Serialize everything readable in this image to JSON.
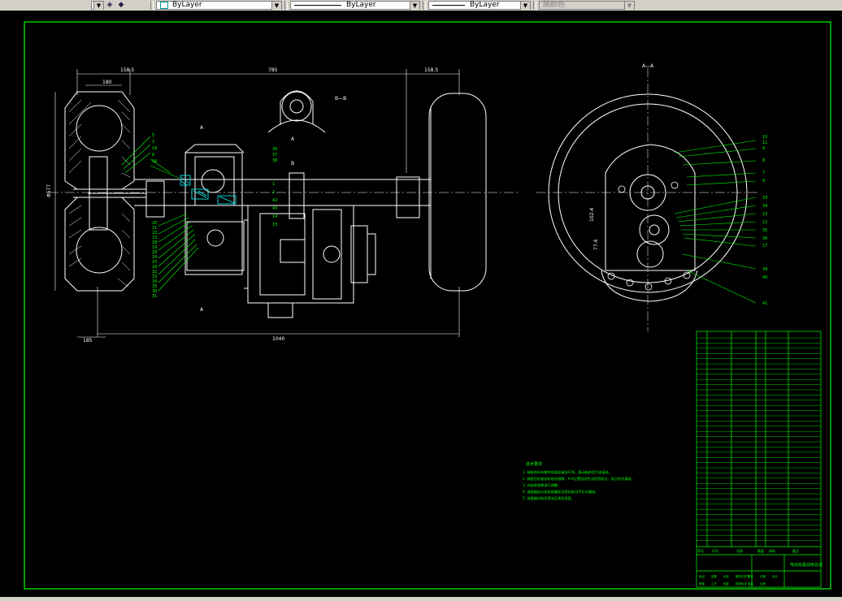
{
  "toolbar": {
    "layer_dropdown": "ByLayer",
    "linetype_dropdown": "ByLayer",
    "lineweight_dropdown": "ByLayer",
    "plotstyle_dropdown": "随颜色"
  },
  "colors": {
    "background": "#000000",
    "border": "#00ff00",
    "geometry": "#ffffff",
    "hatch": "#00ffff",
    "balloons": "#00ff00"
  },
  "drawing": {
    "dimensions": {
      "left_wheel_width": "158.5",
      "axle_span": "785",
      "right_wheel_width": "158.5",
      "inner_width": "180",
      "wheel_diameter": "Φ577",
      "total_width": "1040",
      "left_offset": "185",
      "section_dim_1": "102.4",
      "section_dim_2": "77.4"
    },
    "section_labels": {
      "view_aa": "A—A",
      "view_bb": "B—B",
      "mark_a_top": "A",
      "mark_a_bottom": "A",
      "mark_a_bearing": "A",
      "mark_b": "B"
    },
    "balloons_left": [
      "5",
      "3",
      "18",
      "6",
      "16",
      "20",
      "21",
      "22",
      "23",
      "28",
      "19",
      "29",
      "24",
      "25",
      "26",
      "32",
      "33",
      "34",
      "35",
      "30",
      "31"
    ],
    "balloons_middle": [
      "36",
      "37",
      "38",
      "1",
      "2",
      "42",
      "43",
      "14",
      "15"
    ],
    "balloons_right": [
      "10",
      "11",
      "9",
      "8",
      "7",
      "6",
      "33",
      "34",
      "13",
      "12",
      "35",
      "36",
      "17",
      "39",
      "40",
      "41"
    ],
    "notes_title": "技术要求",
    "notes": [
      "1. 装配前所有零件用煤油清洗干净，滚动轴承用汽油清洗。",
      "2. 装配后检查齿轮啮合侧隙，A-A位置用涂色法检验斑点，斑点符合要求。",
      "3. 对轴承游隙进行调整。",
      "4. 减速器剖分面各接触面及密封处均不允许漏油。",
      "5. 减速器内装润滑油至规定高度。"
    ],
    "title_block": {
      "drawing_name": "电动车驱动桥总成",
      "header_cols": [
        "序号",
        "代号",
        "名称",
        "数量",
        "材料",
        "备注"
      ],
      "bottom_labels": [
        "标记",
        "处数",
        "分区",
        "更改文件号",
        "签名",
        "日期",
        "设计",
        "审核",
        "工艺",
        "批准",
        "阶段标记",
        "重量",
        "比例"
      ]
    }
  }
}
